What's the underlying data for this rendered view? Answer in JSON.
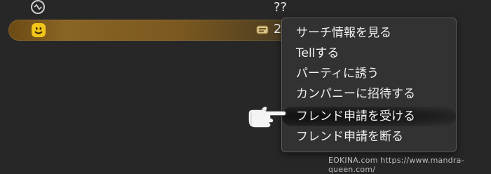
{
  "list": {
    "row_top_name": "??",
    "row_selected_name": "2",
    "row_top_icon": "online-status-icon",
    "row_selected_icon": "smiley-face-icon",
    "row_selected_world_icon": "world-tag-icon"
  },
  "context_menu": {
    "items": [
      {
        "label": "サーチ情報を見る"
      },
      {
        "label": "Tellする"
      },
      {
        "label": "パーティに誘う"
      },
      {
        "label": "カンパニーに招待する"
      },
      {
        "label": "フレンド申請を受ける"
      },
      {
        "label": "フレンド申請を断る"
      }
    ],
    "hovered_index": 4
  },
  "cursor": {
    "icon": "pointing-hand-icon"
  },
  "watermark": "EOKINA.com  https://www.mandra-queen.com/",
  "colors": {
    "background": "#272727",
    "selected_row": "#8a6424",
    "menu_background": "#323232",
    "smiley": "#f2c51a"
  }
}
